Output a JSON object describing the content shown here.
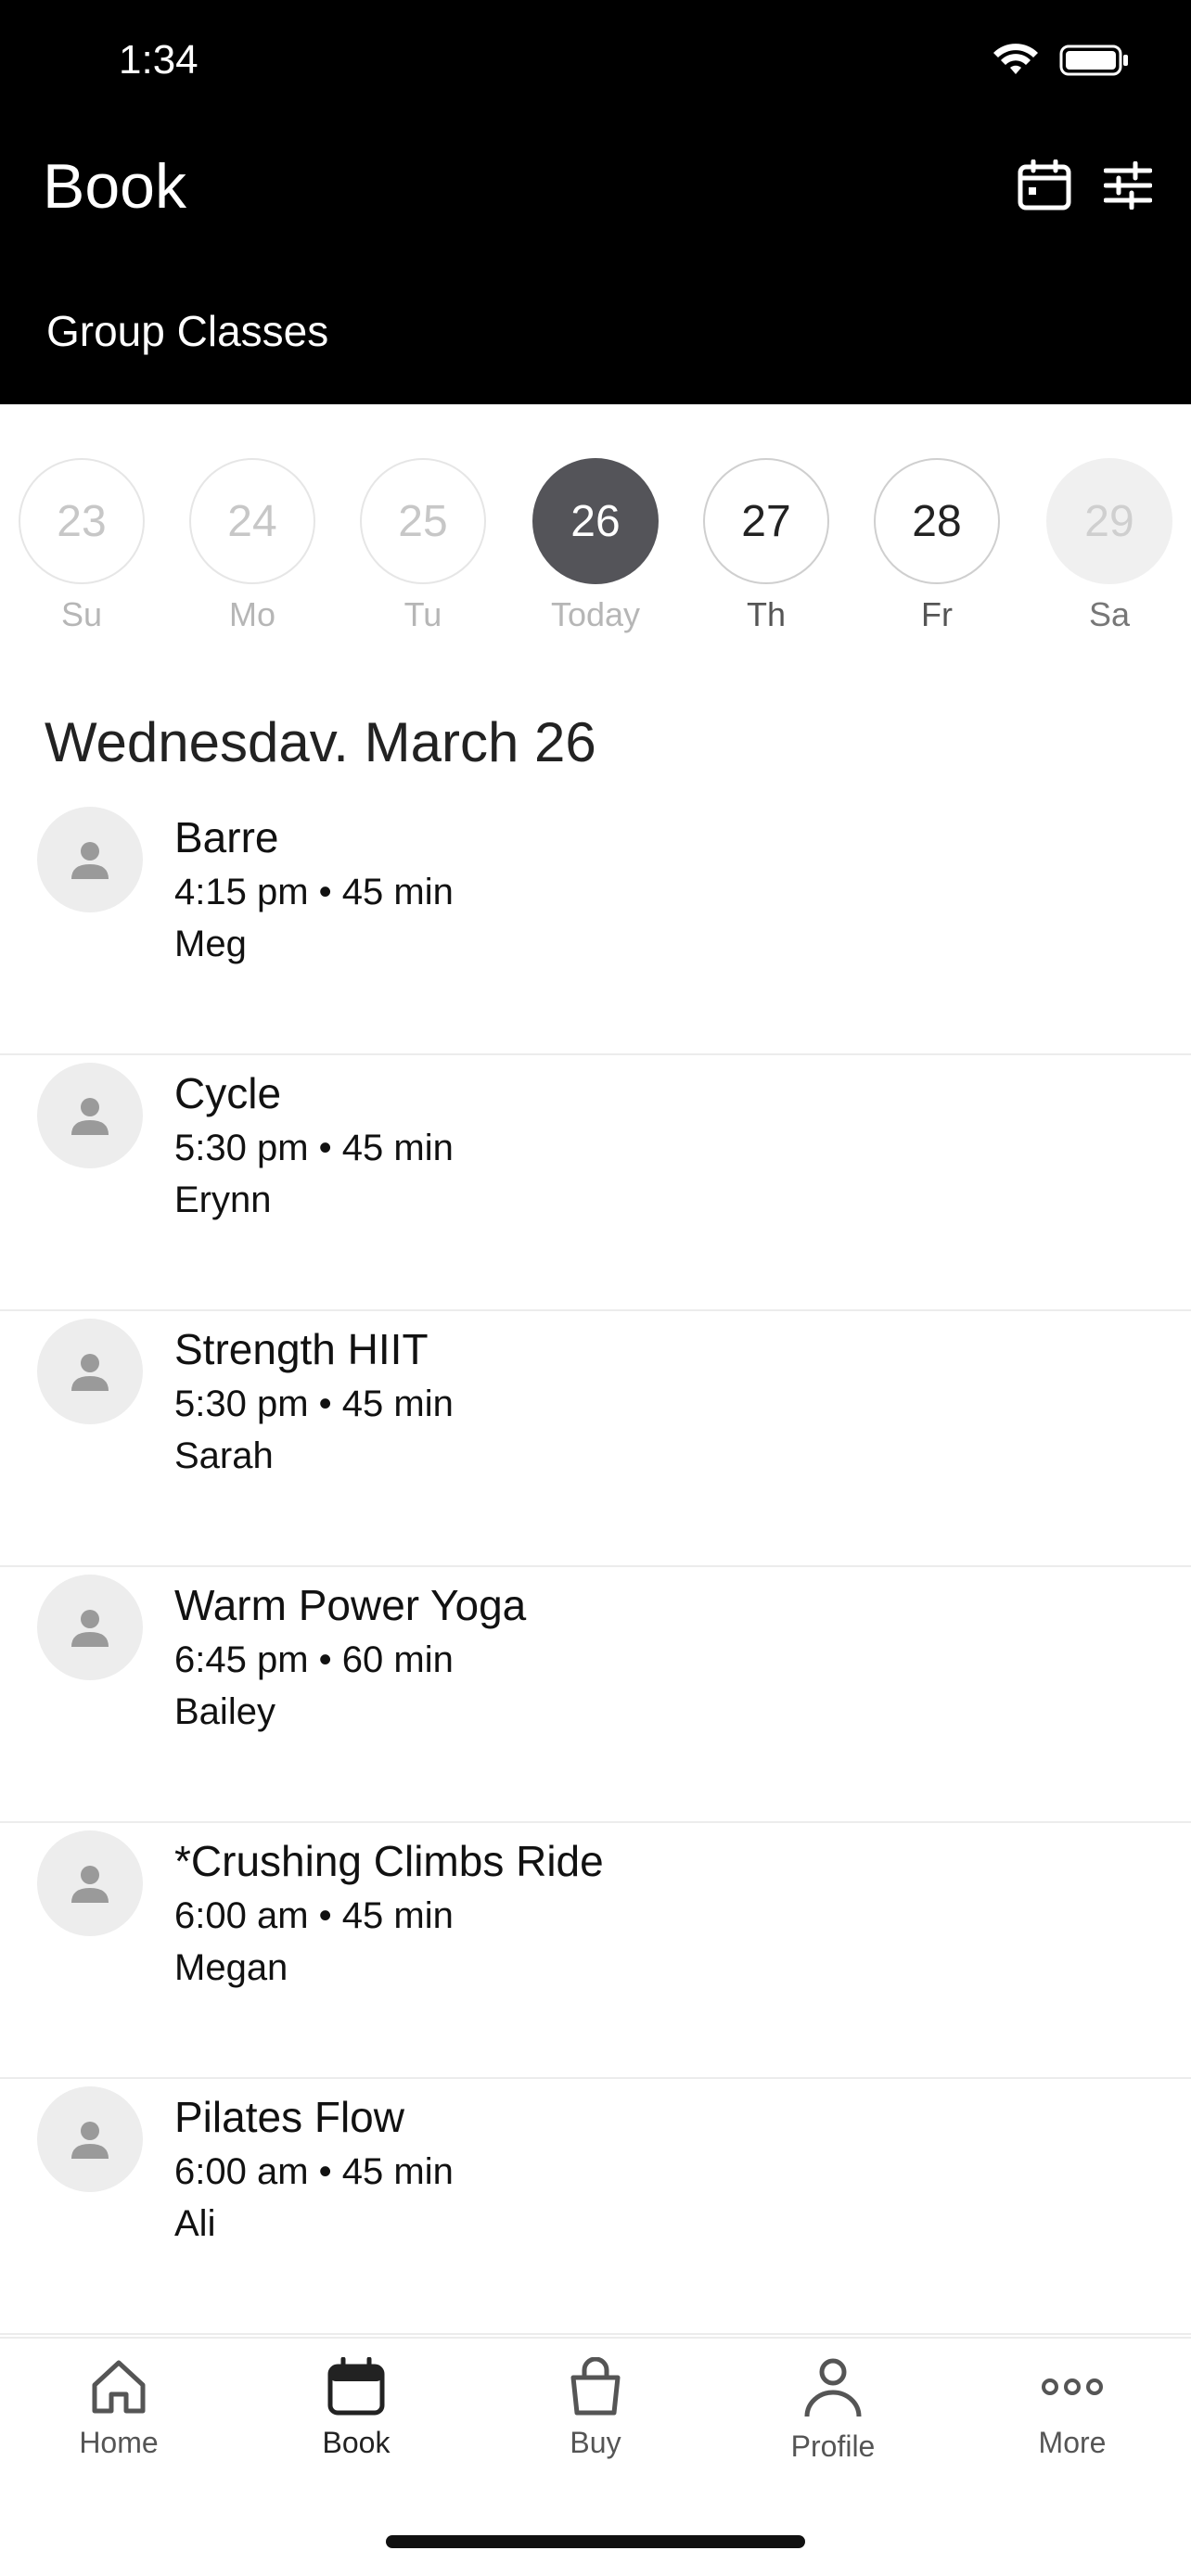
{
  "status_bar": {
    "time": "1:34"
  },
  "header": {
    "title": "Book",
    "subtitle": "Group Classes",
    "actions": [
      {
        "icon": "calendar-icon"
      },
      {
        "icon": "filter-sliders-icon"
      }
    ]
  },
  "days": [
    {
      "number": "23",
      "label": "Su",
      "state": "past"
    },
    {
      "number": "24",
      "label": "Mo",
      "state": "past"
    },
    {
      "number": "25",
      "label": "Tu",
      "state": "past"
    },
    {
      "number": "26",
      "label": "Today",
      "state": "selected"
    },
    {
      "number": "27",
      "label": "Th",
      "state": "available"
    },
    {
      "number": "28",
      "label": "Fr",
      "state": "available"
    },
    {
      "number": "29",
      "label": "Sa",
      "state": "disabled"
    }
  ],
  "date_heading": "Wednesdav. March 26",
  "classes": [
    {
      "name": "Barre",
      "time": "4:15 pm • 45 min",
      "instructor": "Meg"
    },
    {
      "name": "Cycle",
      "time": "5:30 pm • 45 min",
      "instructor": "Erynn"
    },
    {
      "name": "Strength HIIT",
      "time": "5:30 pm • 45 min",
      "instructor": "Sarah"
    },
    {
      "name": "Warm Power Yoga",
      "time": "6:45 pm • 60 min",
      "instructor": "Bailey"
    },
    {
      "name": "*Crushing Climbs Ride",
      "time": "6:00 am • 45 min",
      "instructor": "Megan"
    },
    {
      "name": "Pilates Flow",
      "time": "6:00 am • 45 min",
      "instructor": "Ali"
    }
  ],
  "tabbar": [
    {
      "label": "Home",
      "icon": "home-icon",
      "active": false
    },
    {
      "label": "Book",
      "icon": "calendar-icon",
      "active": true
    },
    {
      "label": "Buy",
      "icon": "shopping-bag-icon",
      "active": false
    },
    {
      "label": "Profile",
      "icon": "person-icon",
      "active": false
    },
    {
      "label": "More",
      "icon": "more-dots-icon",
      "active": false
    }
  ],
  "colors": {
    "header_bg": "#000000",
    "selected_day": "#545459",
    "avatar_bg": "#ededed",
    "divider": "#ececec"
  }
}
